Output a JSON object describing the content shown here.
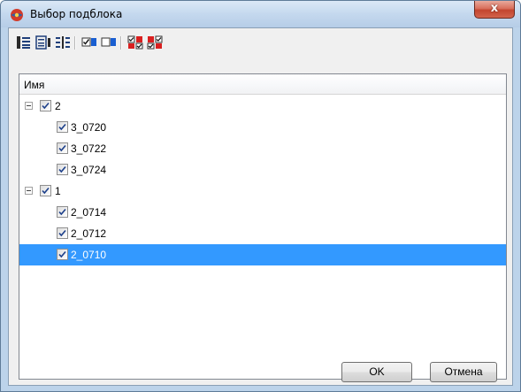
{
  "window": {
    "title": "Выбор подблока",
    "close_glyph": "x"
  },
  "toolbar": {
    "buttons": [
      {
        "icon": "expand-all-icon"
      },
      {
        "icon": "collapse-all-icon"
      },
      {
        "icon": "expand-tree-icon"
      },
      {
        "icon": "check-all-icon"
      },
      {
        "icon": "uncheck-all-icon"
      },
      {
        "icon": "select-checked-icon"
      },
      {
        "icon": "select-unchecked-icon"
      }
    ]
  },
  "tree": {
    "column_header": "Имя",
    "rows": [
      {
        "label": "2",
        "level": 0,
        "expanded": true,
        "checked": true,
        "selected": false
      },
      {
        "label": "3_0720",
        "level": 1,
        "checked": true,
        "selected": false
      },
      {
        "label": "3_0722",
        "level": 1,
        "checked": true,
        "selected": false
      },
      {
        "label": "3_0724",
        "level": 1,
        "checked": true,
        "selected": false
      },
      {
        "label": "1",
        "level": 0,
        "expanded": true,
        "checked": true,
        "selected": false
      },
      {
        "label": "2_0714",
        "level": 1,
        "checked": true,
        "selected": false
      },
      {
        "label": "2_0712",
        "level": 1,
        "checked": true,
        "selected": false
      },
      {
        "label": "2_0710",
        "level": 1,
        "checked": true,
        "selected": true
      }
    ]
  },
  "buttons": {
    "ok": "OK",
    "cancel": "Отмена"
  },
  "colors": {
    "selection": "#3399ff",
    "title_bg": "#c4d8ee",
    "close_red": "#c3452f"
  }
}
